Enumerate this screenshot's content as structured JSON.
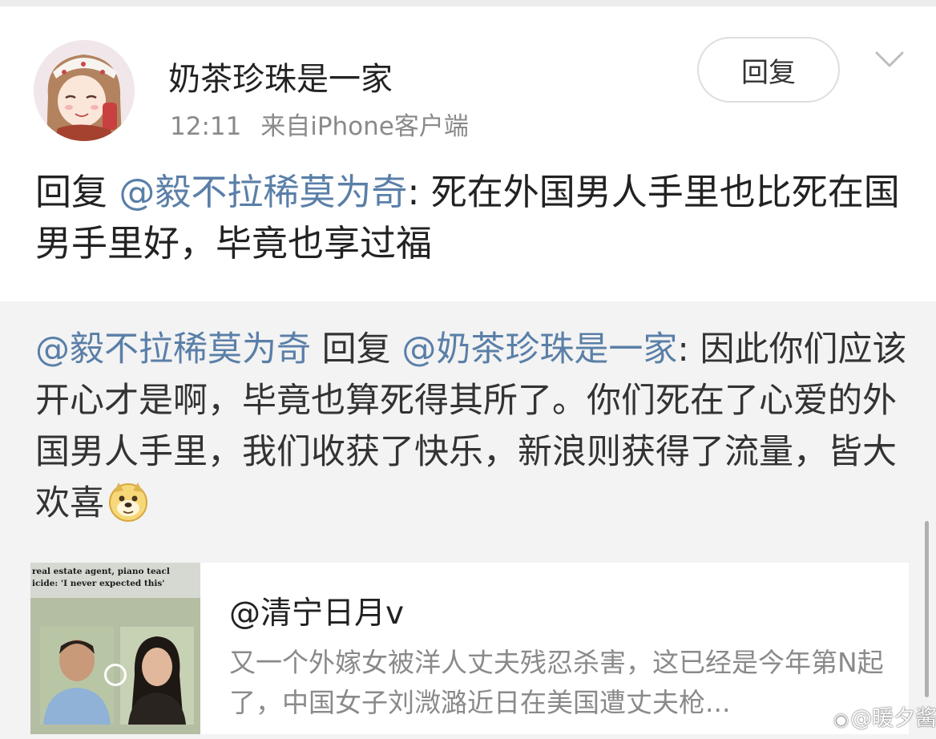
{
  "post": {
    "username": "奶茶珍珠是一家",
    "time": "12:11",
    "source": "来自",
    "source_app": "iPhone",
    "source_suffix": "客户端",
    "reply_button": "回复",
    "icons": [
      "avatar",
      "chevron-down-icon"
    ],
    "text_prefix": "回复",
    "text_mention": "@毅不拉稀莫为奇",
    "text_body": ": 死在外国男人手里也比死在国男手里好，毕竟也享过福"
  },
  "quote": {
    "mention_1": "@毅不拉稀莫为奇",
    "reply_word": " 回复 ",
    "mention_2": "@奶茶珍珠是一家",
    "body": ": 因此你们应该开心才是啊，毕竟也算死得其所了。你们死在了心爱的外国男人手里，我们收获了快乐，新浪则获得了流量，皆大欢喜",
    "emoji": "doge-emoji"
  },
  "card": {
    "thumb_caption_1": "real estate agent, piano teacl",
    "thumb_caption_2": "icide: 'I never expected this'",
    "title": "@清宁日月v",
    "description": "又一个外嫁女被洋人丈夫残忍杀害，这已经是今年第N起了，中国女子刘溦潞近日在美国遭丈夫枪..."
  },
  "watermark": {
    "platform_icon": "weibo-icon",
    "text": "@暖夕酱"
  },
  "colors": {
    "mention": "#5a7fa8",
    "quote_background": "#f3f3f3",
    "meta_text": "#8a8a8a"
  }
}
